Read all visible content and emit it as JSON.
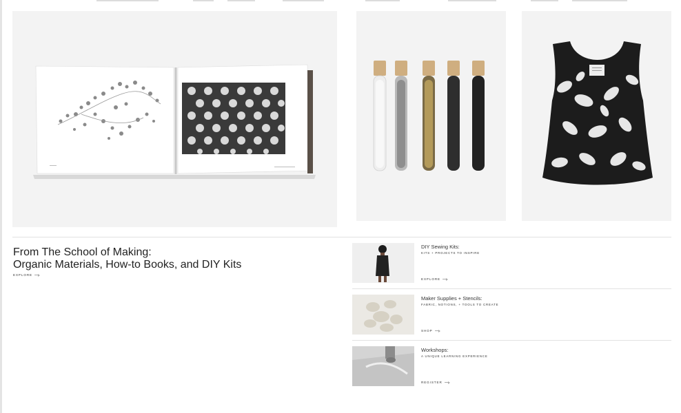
{
  "hero": {
    "title_line1": "From The School of Making:",
    "title_line2": "Organic Materials, How-to Books, and DIY Kits",
    "explore_label": "EXPLORE"
  },
  "products": [
    {
      "name": "book"
    },
    {
      "name": "sequin-tubes"
    },
    {
      "name": "floral-top"
    }
  ],
  "promos": [
    {
      "title": "DIY Sewing Kits:",
      "subtitle": "KITS + PROJECTS TO INSPIRE",
      "cta": "EXPLORE",
      "thumb_icon": "model-photo"
    },
    {
      "title": "Maker Supplies + Stencils:",
      "subtitle": "FABRIC, NOTIONS, + TOOLS TO CREATE",
      "cta": "SHOP",
      "thumb_icon": "stencil-photo"
    },
    {
      "title": "Workshops:",
      "subtitle": "A UNIQUE LEARNING EXPERIENCE",
      "cta": "REGISTER",
      "thumb_icon": "workshop-photo"
    }
  ],
  "colors": {
    "panel_bg": "#f3f3f3",
    "divider": "#e2e2e2",
    "text": "#222222"
  }
}
